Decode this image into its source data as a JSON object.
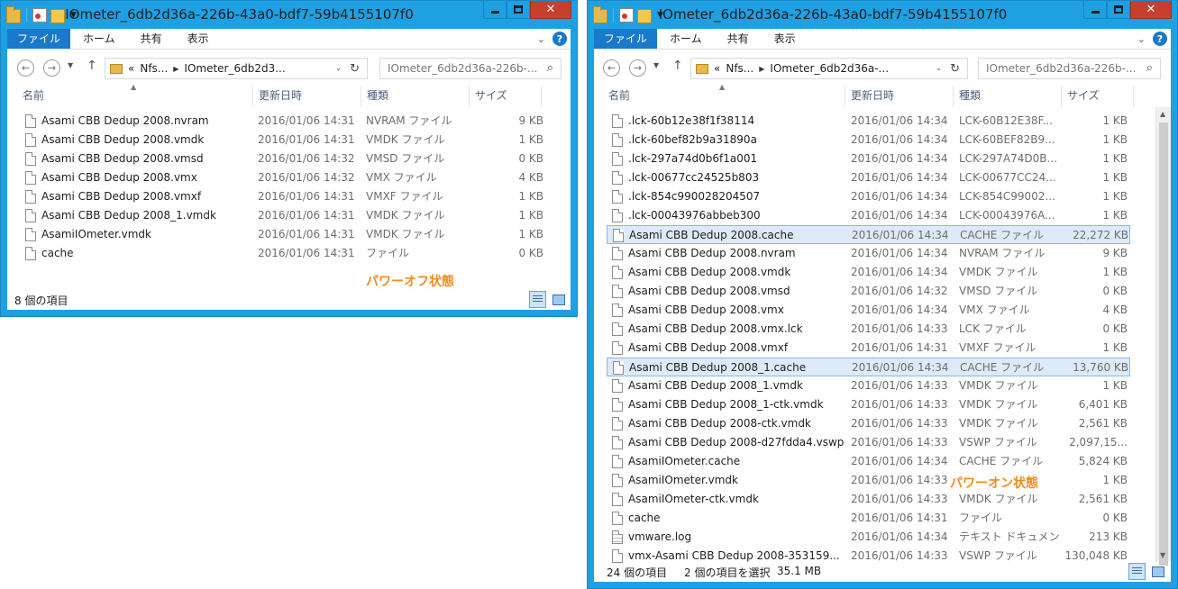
{
  "left_window": {
    "title": "IOmeter_6db2d36a-226b-43a0-bdf7-59b4155107f0",
    "ribbon_tabs": [
      "ファイル",
      "ホーム",
      "共有",
      "表示"
    ],
    "address": {
      "prefix": "«",
      "segments": [
        "Nfs...",
        "IOmeter_6db2d3..."
      ]
    },
    "search_placeholder": "IOmeter_6db2d36a-226b-...",
    "columns": {
      "name": "名前",
      "date": "更新日時",
      "type": "種類",
      "size": "サイズ"
    },
    "files": [
      {
        "name": "Asami CBB Dedup 2008.nvram",
        "date": "2016/01/06 14:31",
        "type": "NVRAM ファイル",
        "size": "9 KB"
      },
      {
        "name": "Asami CBB Dedup 2008.vmdk",
        "date": "2016/01/06 14:31",
        "type": "VMDK ファイル",
        "size": "1 KB"
      },
      {
        "name": "Asami CBB Dedup 2008.vmsd",
        "date": "2016/01/06 14:32",
        "type": "VMSD ファイル",
        "size": "0 KB"
      },
      {
        "name": "Asami CBB Dedup 2008.vmx",
        "date": "2016/01/06 14:32",
        "type": "VMX ファイル",
        "size": "4 KB"
      },
      {
        "name": "Asami CBB Dedup 2008.vmxf",
        "date": "2016/01/06 14:31",
        "type": "VMXF ファイル",
        "size": "1 KB"
      },
      {
        "name": "Asami CBB Dedup 2008_1.vmdk",
        "date": "2016/01/06 14:31",
        "type": "VMDK ファイル",
        "size": "1 KB"
      },
      {
        "name": "AsamiIOmeter.vmdk",
        "date": "2016/01/06 14:31",
        "type": "VMDK ファイル",
        "size": "1 KB"
      },
      {
        "name": "cache",
        "date": "2016/01/06 14:31",
        "type": "ファイル",
        "size": "0 KB"
      }
    ],
    "status": {
      "item_count": "8 個の項目"
    },
    "annotation": "パワーオフ状態"
  },
  "right_window": {
    "title": "IOmeter_6db2d36a-226b-43a0-bdf7-59b4155107f0",
    "ribbon_tabs": [
      "ファイル",
      "ホーム",
      "共有",
      "表示"
    ],
    "address": {
      "prefix": "«",
      "segments": [
        "Nfs...",
        "IOmeter_6db2d36a-..."
      ]
    },
    "search_placeholder": "IOmeter_6db2d36a-226b-...",
    "columns": {
      "name": "名前",
      "date": "更新日時",
      "type": "種類",
      "size": "サイズ"
    },
    "files": [
      {
        "name": ".lck-60b12e38f1f38114",
        "date": "2016/01/06 14:34",
        "type": "LCK-60B12E38F...",
        "size": "1 KB",
        "selected": false,
        "icon": "file-icon"
      },
      {
        "name": ".lck-60bef82b9a31890a",
        "date": "2016/01/06 14:34",
        "type": "LCK-60BEF82B9...",
        "size": "1 KB",
        "selected": false,
        "icon": "file-icon"
      },
      {
        "name": ".lck-297a74d0b6f1a001",
        "date": "2016/01/06 14:34",
        "type": "LCK-297A74D0B...",
        "size": "1 KB",
        "selected": false,
        "icon": "file-icon"
      },
      {
        "name": ".lck-00677cc24525b803",
        "date": "2016/01/06 14:34",
        "type": "LCK-00677CC24...",
        "size": "1 KB",
        "selected": false,
        "icon": "file-icon"
      },
      {
        "name": ".lck-854c990028204507",
        "date": "2016/01/06 14:34",
        "type": "LCK-854C99002...",
        "size": "1 KB",
        "selected": false,
        "icon": "file-icon"
      },
      {
        "name": ".lck-00043976abbeb300",
        "date": "2016/01/06 14:34",
        "type": "LCK-00043976A...",
        "size": "1 KB",
        "selected": false,
        "icon": "file-icon"
      },
      {
        "name": "Asami CBB Dedup 2008.cache",
        "date": "2016/01/06 14:34",
        "type": "CACHE ファイル",
        "size": "22,272 KB",
        "selected": true,
        "icon": "file-icon"
      },
      {
        "name": "Asami CBB Dedup 2008.nvram",
        "date": "2016/01/06 14:34",
        "type": "NVRAM ファイル",
        "size": "9 KB",
        "selected": false,
        "icon": "file-icon"
      },
      {
        "name": "Asami CBB Dedup 2008.vmdk",
        "date": "2016/01/06 14:34",
        "type": "VMDK ファイル",
        "size": "1 KB",
        "selected": false,
        "icon": "file-icon"
      },
      {
        "name": "Asami CBB Dedup 2008.vmsd",
        "date": "2016/01/06 14:32",
        "type": "VMSD ファイル",
        "size": "0 KB",
        "selected": false,
        "icon": "file-icon"
      },
      {
        "name": "Asami CBB Dedup 2008.vmx",
        "date": "2016/01/06 14:34",
        "type": "VMX ファイル",
        "size": "4 KB",
        "selected": false,
        "icon": "file-icon"
      },
      {
        "name": "Asami CBB Dedup 2008.vmx.lck",
        "date": "2016/01/06 14:33",
        "type": "LCK ファイル",
        "size": "0 KB",
        "selected": false,
        "icon": "file-icon"
      },
      {
        "name": "Asami CBB Dedup 2008.vmxf",
        "date": "2016/01/06 14:31",
        "type": "VMXF ファイル",
        "size": "1 KB",
        "selected": false,
        "icon": "file-icon"
      },
      {
        "name": "Asami CBB Dedup 2008_1.cache",
        "date": "2016/01/06 14:34",
        "type": "CACHE ファイル",
        "size": "13,760 KB",
        "selected": true,
        "icon": "file-icon"
      },
      {
        "name": "Asami CBB Dedup 2008_1.vmdk",
        "date": "2016/01/06 14:33",
        "type": "VMDK ファイル",
        "size": "1 KB",
        "selected": false,
        "icon": "file-icon"
      },
      {
        "name": "Asami CBB Dedup 2008_1-ctk.vmdk",
        "date": "2016/01/06 14:33",
        "type": "VMDK ファイル",
        "size": "6,401 KB",
        "selected": false,
        "icon": "file-icon"
      },
      {
        "name": "Asami CBB Dedup 2008-ctk.vmdk",
        "date": "2016/01/06 14:33",
        "type": "VMDK ファイル",
        "size": "2,561 KB",
        "selected": false,
        "icon": "file-icon"
      },
      {
        "name": "Asami CBB Dedup 2008-d27fdda4.vswp",
        "date": "2016/01/06 14:33",
        "type": "VSWP ファイル",
        "size": "2,097,15...",
        "selected": false,
        "icon": "file-icon"
      },
      {
        "name": "AsamiIOmeter.cache",
        "date": "2016/01/06 14:34",
        "type": "CACHE ファイル",
        "size": "5,824 KB",
        "selected": false,
        "icon": "file-icon"
      },
      {
        "name": "AsamiIOmeter.vmdk",
        "date": "2016/01/06 14:33",
        "type": "",
        "size": "1 KB",
        "selected": false,
        "icon": "file-icon"
      },
      {
        "name": "AsamiIOmeter-ctk.vmdk",
        "date": "2016/01/06 14:33",
        "type": "VMDK ファイル",
        "size": "2,561 KB",
        "selected": false,
        "icon": "file-icon"
      },
      {
        "name": "cache",
        "date": "2016/01/06 14:31",
        "type": "ファイル",
        "size": "0 KB",
        "selected": false,
        "icon": "file-icon"
      },
      {
        "name": "vmware.log",
        "date": "2016/01/06 14:34",
        "type": "テキスト ドキュメント",
        "size": "213 KB",
        "selected": false,
        "icon": "text-document-icon"
      },
      {
        "name": "vmx-Asami CBB Dedup 2008-353159...",
        "date": "2016/01/06 14:33",
        "type": "VSWP ファイル",
        "size": "130,048 KB",
        "selected": false,
        "icon": "file-icon"
      }
    ],
    "status": {
      "item_count": "24 個の項目",
      "selection": "2 個の項目を選択",
      "selection_size": "35.1 MB"
    },
    "annotation": "パワーオン状態"
  },
  "colors": {
    "title_bar": "#1ea0e3",
    "file_tab": "#1979ca",
    "close_button": "#c7402e",
    "annotation": "#f28c1c",
    "selection": "#ddeaf8"
  }
}
